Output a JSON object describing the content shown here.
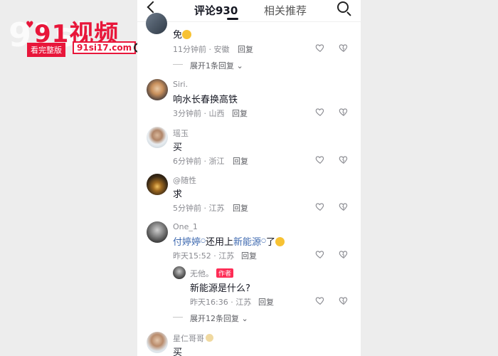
{
  "watermark": {
    "bg_text": "91si",
    "title": "91视频",
    "tag": "看完整版",
    "url": "91si17.com"
  },
  "tabs": {
    "comments": "评论930",
    "related": "相关推荐"
  },
  "comments": [
    {
      "name": "",
      "text": "免",
      "time": "11分钟前 · 安徽",
      "reply": "回复",
      "expand": "展开1条回复"
    },
    {
      "name": "Siri.",
      "text": "响水长春换高铁",
      "time": "3分钟前 · 山西",
      "reply": "回复"
    },
    {
      "name": "瑶玉",
      "text": "买",
      "time": "6分钟前 · 浙江",
      "reply": "回复"
    },
    {
      "name": "@随性",
      "text": "求",
      "time": "5分钟前 · 江苏",
      "reply": "回复"
    },
    {
      "name": "One_1",
      "mention1": "付婷婷",
      "text_mid": "还用上",
      "mention2": "新能源",
      "text_end": "了",
      "time": "昨天15:52 · 江苏",
      "reply": "回复"
    },
    {
      "name": "星仁哥哥",
      "text": "买"
    }
  ],
  "sub_reply": {
    "name": "无他。",
    "badge": "作者",
    "text": "新能源是什么?",
    "time": "昨天16:36 · 江苏",
    "reply": "回复",
    "expand": "展开12条回复"
  },
  "colors": {
    "brand": "#e8163a",
    "mention": "#3f6ab0",
    "badge": "#fe2c55"
  }
}
